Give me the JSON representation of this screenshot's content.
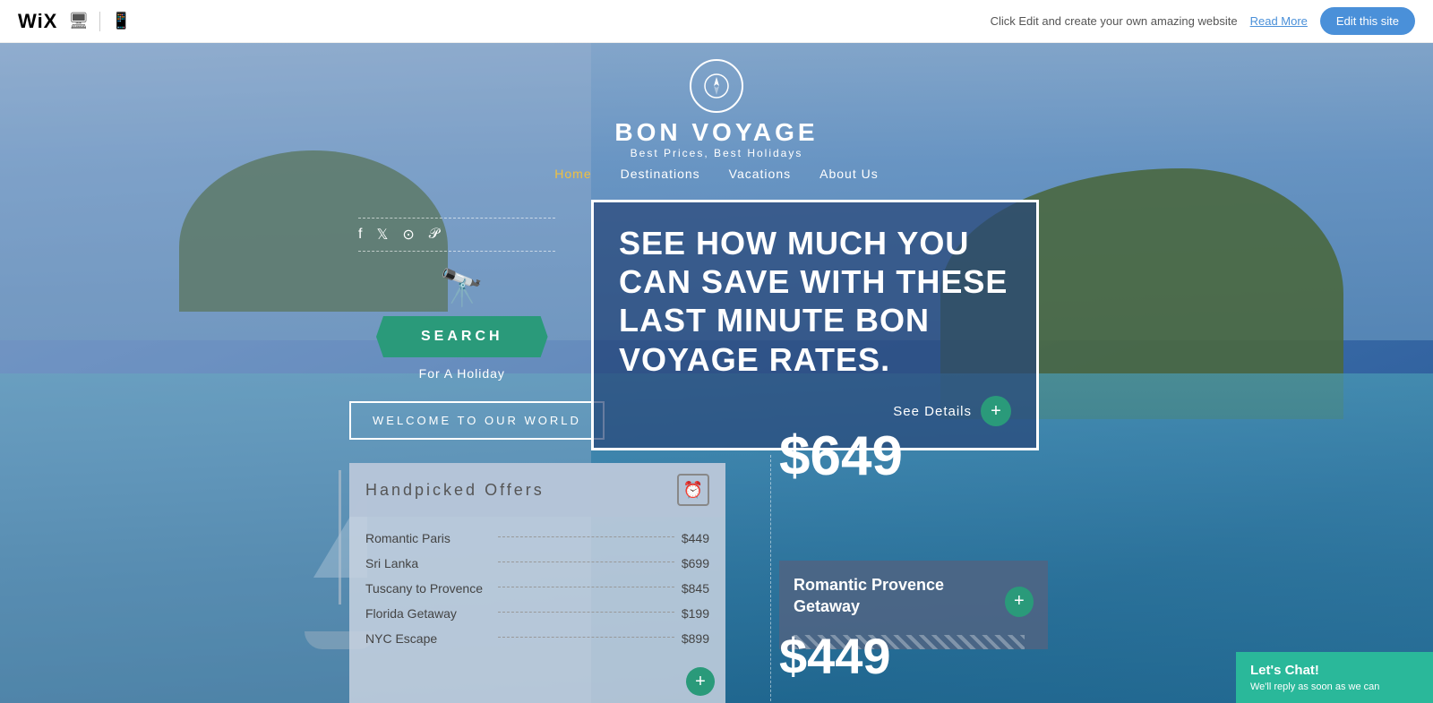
{
  "topbar": {
    "logo": "WiX",
    "desktop_icon": "🖥",
    "mobile_icon": "📱",
    "promo_text": "Click Edit and create your own amazing website",
    "read_more": "Read More",
    "edit_btn": "Edit this site"
  },
  "brand": {
    "name": "BON VOYAGE",
    "tagline": "Best Prices, Best Holidays",
    "compass": "▲"
  },
  "nav": {
    "items": [
      {
        "label": "Home",
        "active": true
      },
      {
        "label": "Destinations",
        "active": false
      },
      {
        "label": "Vacations",
        "active": false
      },
      {
        "label": "About Us",
        "active": false
      }
    ]
  },
  "social": {
    "icons": [
      "f",
      "t",
      "ig",
      "p"
    ]
  },
  "search": {
    "button_label": "SEARCH",
    "sub_label": "For A Holiday"
  },
  "welcome": {
    "label": "WELCOME TO OUR WORLD"
  },
  "promo": {
    "text": "SEE HOW MUCH YOU CAN SAVE WITH THESE LAST MINUTE BON VOYAGE RATES.",
    "see_details": "See Details",
    "plus": "+"
  },
  "offers": {
    "title": "Handpicked Offers",
    "items": [
      {
        "name": "Romantic Paris",
        "price": "$449"
      },
      {
        "name": "Sri Lanka",
        "price": "$699"
      },
      {
        "name": "Tuscany to Provence",
        "price": "$845"
      },
      {
        "name": "Florida Getaway",
        "price": "$199"
      },
      {
        "name": "NYC Escape",
        "price": "$899"
      }
    ],
    "plus": "+"
  },
  "pricing": {
    "main_price": "$649",
    "secondary_price": "$449"
  },
  "provence": {
    "title": "Romantic Provence Getaway",
    "plus": "+"
  },
  "chat": {
    "title": "Let's Chat!",
    "subtitle": "We'll reply as soon as we can"
  }
}
